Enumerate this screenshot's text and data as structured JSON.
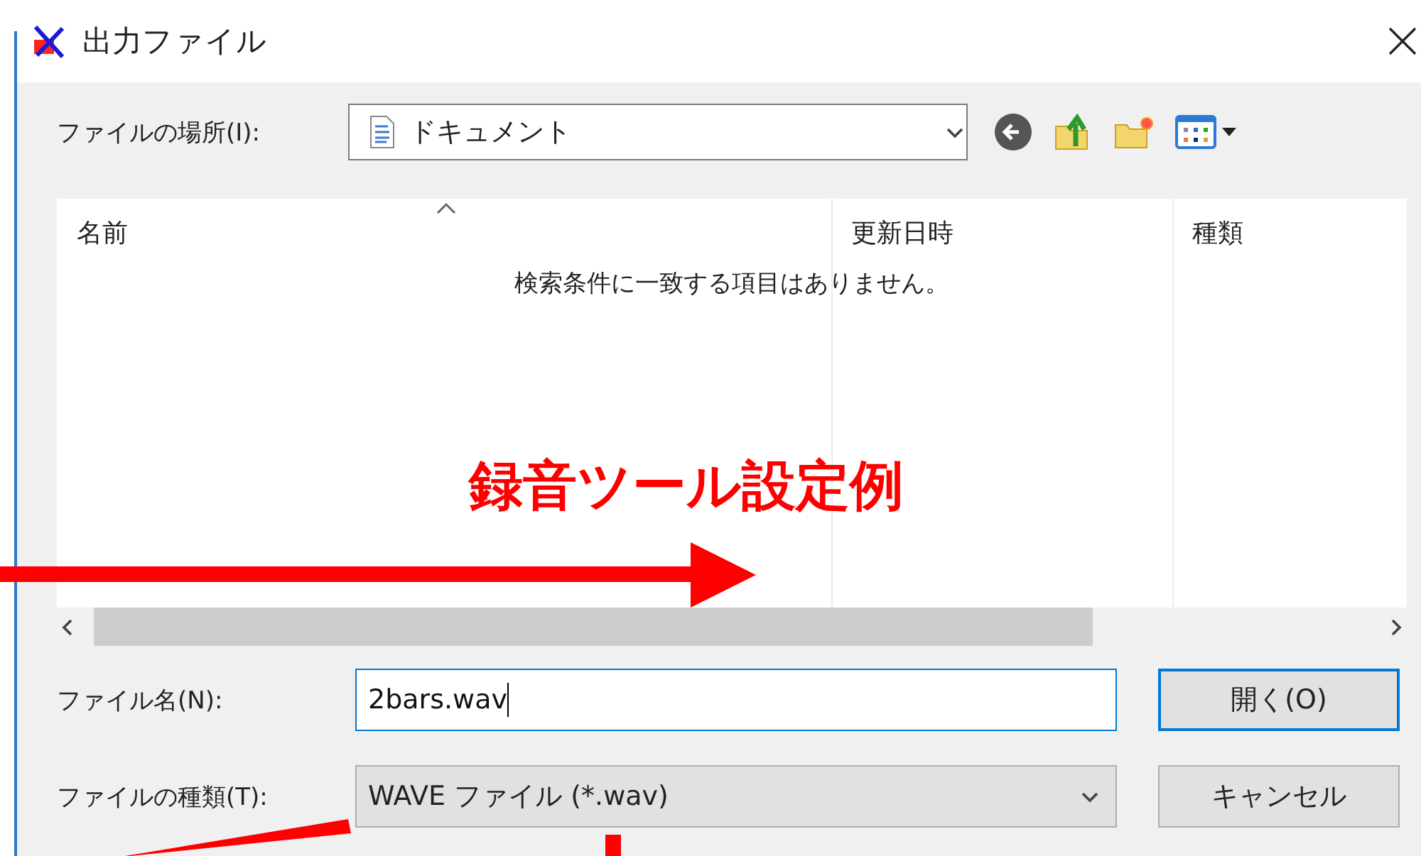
{
  "window": {
    "title": "出力ファイル"
  },
  "location": {
    "label": "ファイルの場所(I):",
    "value": "ドキュメント"
  },
  "file_list": {
    "columns": [
      "名前",
      "更新日時",
      "種類"
    ],
    "empty_message": "検索条件に一致する項目はありません。"
  },
  "annotation": {
    "text": "録音ツール設定例"
  },
  "file_name": {
    "label": "ファイル名(N):",
    "value": "2bars.wav"
  },
  "file_type": {
    "label": "ファイルの種類(T):",
    "value": "WAVE ファイル (*.wav)"
  },
  "buttons": [
    {
      "label": "開く(O)",
      "kind": "default"
    },
    {
      "label": "キャンセル",
      "kind": "normal"
    }
  ]
}
